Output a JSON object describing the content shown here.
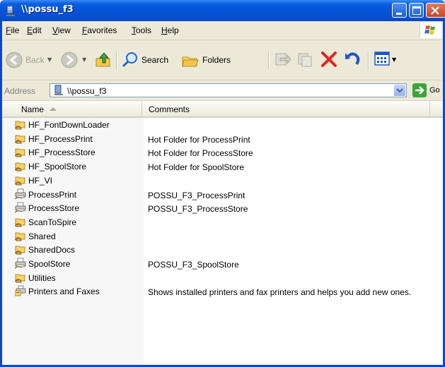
{
  "window": {
    "title": "\\\\possu_f3"
  },
  "menu": [
    {
      "label": "File"
    },
    {
      "label": "Edit"
    },
    {
      "label": "View"
    },
    {
      "label": "Favorites"
    },
    {
      "label": "Tools"
    },
    {
      "label": "Help"
    }
  ],
  "toolbar": {
    "back_label": "Back",
    "search_label": "Search",
    "folders_label": "Folders"
  },
  "address": {
    "label": "Address",
    "value": "\\\\possu_f3",
    "go_label": "Go"
  },
  "columns": {
    "name": "Name",
    "comments": "Comments"
  },
  "items": [
    {
      "name": "HF_FontDownLoader",
      "comment": "",
      "icon": "shared-folder-icon"
    },
    {
      "name": "HF_ProcessPrint",
      "comment": "Hot Folder for ProcessPrint",
      "icon": "shared-folder-icon"
    },
    {
      "name": "HF_ProcessStore",
      "comment": "Hot Folder for ProcessStore",
      "icon": "shared-folder-icon"
    },
    {
      "name": "HF_SpoolStore",
      "comment": "Hot Folder for SpoolStore",
      "icon": "shared-folder-icon"
    },
    {
      "name": "HF_VI",
      "comment": "",
      "icon": "shared-folder-icon"
    },
    {
      "name": "ProcessPrint",
      "comment": "POSSU_F3_ProcessPrint",
      "icon": "shared-printer-icon"
    },
    {
      "name": "ProcessStore",
      "comment": "POSSU_F3_ProcessStore",
      "icon": "shared-printer-icon"
    },
    {
      "name": "ScanToSpire",
      "comment": "",
      "icon": "shared-folder-icon"
    },
    {
      "name": "Shared",
      "comment": "",
      "icon": "shared-folder-icon"
    },
    {
      "name": "SharedDocs",
      "comment": "",
      "icon": "shared-folder-icon"
    },
    {
      "name": "SpoolStore",
      "comment": "POSSU_F3_SpoolStore",
      "icon": "shared-printer-icon"
    },
    {
      "name": "Utilities",
      "comment": "",
      "icon": "shared-folder-icon"
    },
    {
      "name": "Printers and Faxes",
      "comment": "Shows installed printers and fax printers and helps you add new ones.",
      "icon": "printers-faxes-icon"
    }
  ],
  "colors": {
    "titlebar": "#0653d6",
    "chrome": "#ece9d8",
    "sorted_column": "#f7f7f7"
  }
}
